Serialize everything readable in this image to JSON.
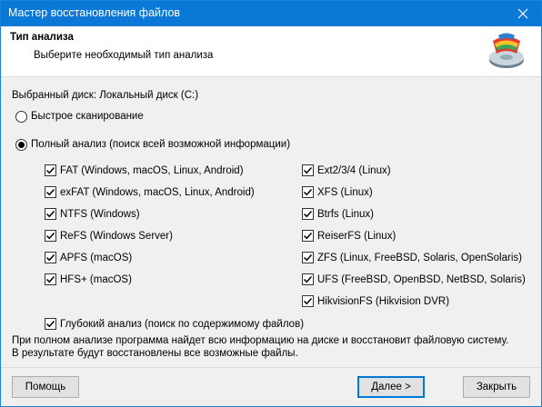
{
  "window": {
    "title": "Мастер восстановления файлов"
  },
  "header": {
    "title": "Тип анализа",
    "subtitle": "Выберите необходимый тип анализа"
  },
  "disk_label": "Выбранный диск: Локальный диск (C:)",
  "scan_options": {
    "quick": {
      "label": "Быстрое сканирование",
      "selected": false
    },
    "full": {
      "label": "Полный анализ (поиск всей возможной информации)",
      "selected": true
    }
  },
  "filesystems_left": [
    {
      "label": "FAT (Windows, macOS, Linux, Android)",
      "checked": true
    },
    {
      "label": "exFAT (Windows, macOS, Linux, Android)",
      "checked": true
    },
    {
      "label": "NTFS (Windows)",
      "checked": true
    },
    {
      "label": "ReFS (Windows Server)",
      "checked": true
    },
    {
      "label": "APFS (macOS)",
      "checked": true
    },
    {
      "label": "HFS+ (macOS)",
      "checked": true
    }
  ],
  "filesystems_right": [
    {
      "label": "Ext2/3/4 (Linux)",
      "checked": true
    },
    {
      "label": "XFS (Linux)",
      "checked": true
    },
    {
      "label": "Btrfs (Linux)",
      "checked": true
    },
    {
      "label": "ReiserFS (Linux)",
      "checked": true
    },
    {
      "label": "ZFS (Linux, FreeBSD, Solaris, OpenSolaris)",
      "checked": true
    },
    {
      "label": "UFS (FreeBSD, OpenBSD, NetBSD, Solaris)",
      "checked": true
    },
    {
      "label": "HikvisionFS (Hikvision DVR)",
      "checked": true
    }
  ],
  "deep_analysis": {
    "label": "Глубокий анализ (поиск по содержимому файлов)",
    "checked": true
  },
  "info": {
    "line1": "При полном анализе программа найдет всю информацию на диске и восстановит файловую систему.",
    "line2": "В результате будут восстановлены все возможные файлы."
  },
  "buttons": {
    "help": "Помощь",
    "next": "Далее >",
    "close": "Закрыть"
  },
  "icons": {
    "close": "close-icon",
    "logo": "disk-recovery-logo-icon",
    "check": "checkmark-icon"
  }
}
